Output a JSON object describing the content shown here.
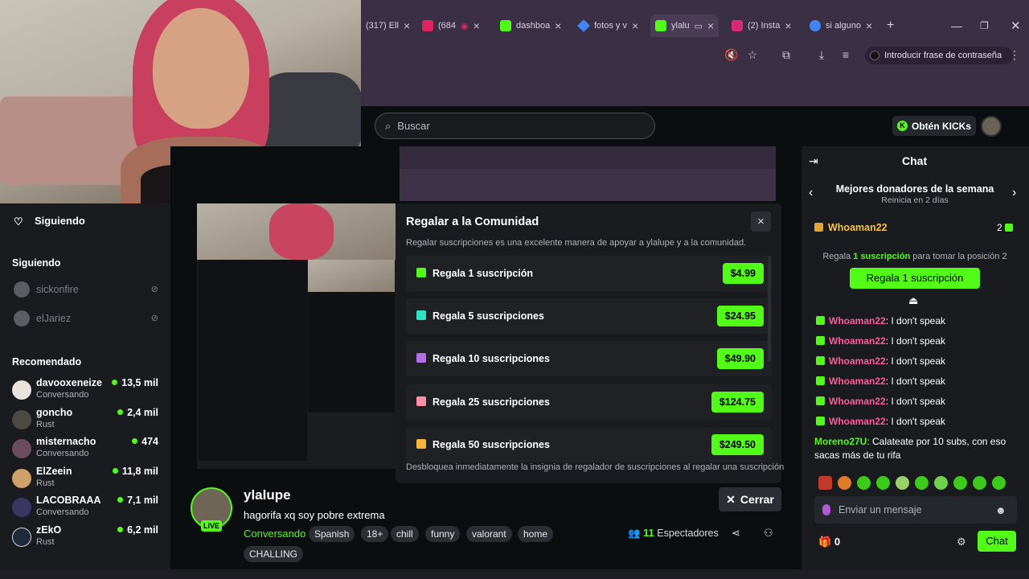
{
  "browser": {
    "tabs": [
      {
        "label": "(317) Ell",
        "icon_color": "#ff0000"
      },
      {
        "label": "(684",
        "icon_color": "#e0245e"
      },
      {
        "label": "dashboa",
        "icon_color": "#53fc18"
      },
      {
        "label": "fotos y v",
        "icon_color": "#4285f4"
      },
      {
        "label": "ylalu",
        "icon_color": "#53fc18"
      },
      {
        "label": "(2) Insta",
        "icon_color": "#d62976"
      },
      {
        "label": "si alguno",
        "icon_color": "#4285f4"
      }
    ],
    "new_tab": "+",
    "passphrase": "Introducir frase de contraseña"
  },
  "header": {
    "search_placeholder": "Buscar",
    "kicks_label": "Obtén KICKs"
  },
  "sidebar": {
    "following_header": "Siguiendo",
    "following_section": "Siguiendo",
    "following": [
      {
        "name": "sickonfire"
      },
      {
        "name": "elJariez"
      }
    ],
    "recommended_header": "Recomendado",
    "recommended": [
      {
        "name": "davooxeneize",
        "category": "Conversando",
        "viewers": "13,5 mil"
      },
      {
        "name": "goncho",
        "category": "Rust",
        "viewers": "2,4 mil"
      },
      {
        "name": "misternacho",
        "category": "Conversando",
        "viewers": "474"
      },
      {
        "name": "ElZeein",
        "category": "Rust",
        "viewers": "11,8 mil"
      },
      {
        "name": "LACOBRAAA",
        "category": "Conversando",
        "viewers": "7,1 mil"
      },
      {
        "name": "zEkO",
        "category": "Rust",
        "viewers": "6,2 mil"
      }
    ]
  },
  "modal": {
    "title": "Regalar a la Comunidad",
    "subtitle": "Regalar suscripciones es una excelente manera de apoyar a ylalupe y a la comunidad.",
    "close": "×",
    "options": [
      {
        "label": "Regala 1 suscripción",
        "price": "$4.99",
        "color": "#53fc18"
      },
      {
        "label": "Regala 5 suscripciones",
        "price": "$24.95",
        "color": "#2fe0c4"
      },
      {
        "label": "Regala 10 suscripciones",
        "price": "$49.90",
        "color": "#b36ee8"
      },
      {
        "label": "Regala 25 suscripciones",
        "price": "$124.75",
        "color": "#ff8fa8"
      },
      {
        "label": "Regala 50 suscripciones",
        "price": "$249.50",
        "color": "#f6b53a"
      }
    ],
    "footer": "Desbloquea inmediatamente la insignia de regalador de suscripciones al regalar una suscripción"
  },
  "stream": {
    "live": "LIVE",
    "streamer": "ylalupe",
    "title": "hagorifa xq soy pobre extrema",
    "category": "Conversando",
    "tags": [
      "Spanish",
      "18+",
      "chill",
      "funny",
      "valorant",
      "home",
      "CHALLING"
    ],
    "viewers_count": "11",
    "viewers_label": "Espectadores",
    "close_label": "Cerrar"
  },
  "chat": {
    "title": "Chat",
    "donors_title": "Mejores donadores de la semana",
    "donors_sub": "Reinicia en 2 días",
    "top_donor": "Whoaman22",
    "top_donor_count": "2",
    "hint_prefix": "Regala",
    "hint_highlight": "1 suscripción",
    "hint_suffix": "para tomar la posición 2",
    "gift_button": "Regala 1 suscripción",
    "messages": [
      {
        "user": "Whoaman22",
        "text": ": I don't speak"
      },
      {
        "user": "Whoaman22",
        "text": ": I don't speak"
      },
      {
        "user": "Whoaman22",
        "text": ": I don't speak"
      },
      {
        "user": "Whoaman22",
        "text": ": I don't speak"
      },
      {
        "user": "Whoaman22",
        "text": ": I don't speak"
      },
      {
        "user": "Whoaman22",
        "text": ": I don't speak"
      }
    ],
    "long_message": {
      "user": "Moreno27U",
      "text": ": Calateate por 10 subs, con eso sacas más de tu rifa"
    },
    "input_placeholder": "Enviar un mensaje",
    "gift_count": "0",
    "send_label": "Chat"
  }
}
